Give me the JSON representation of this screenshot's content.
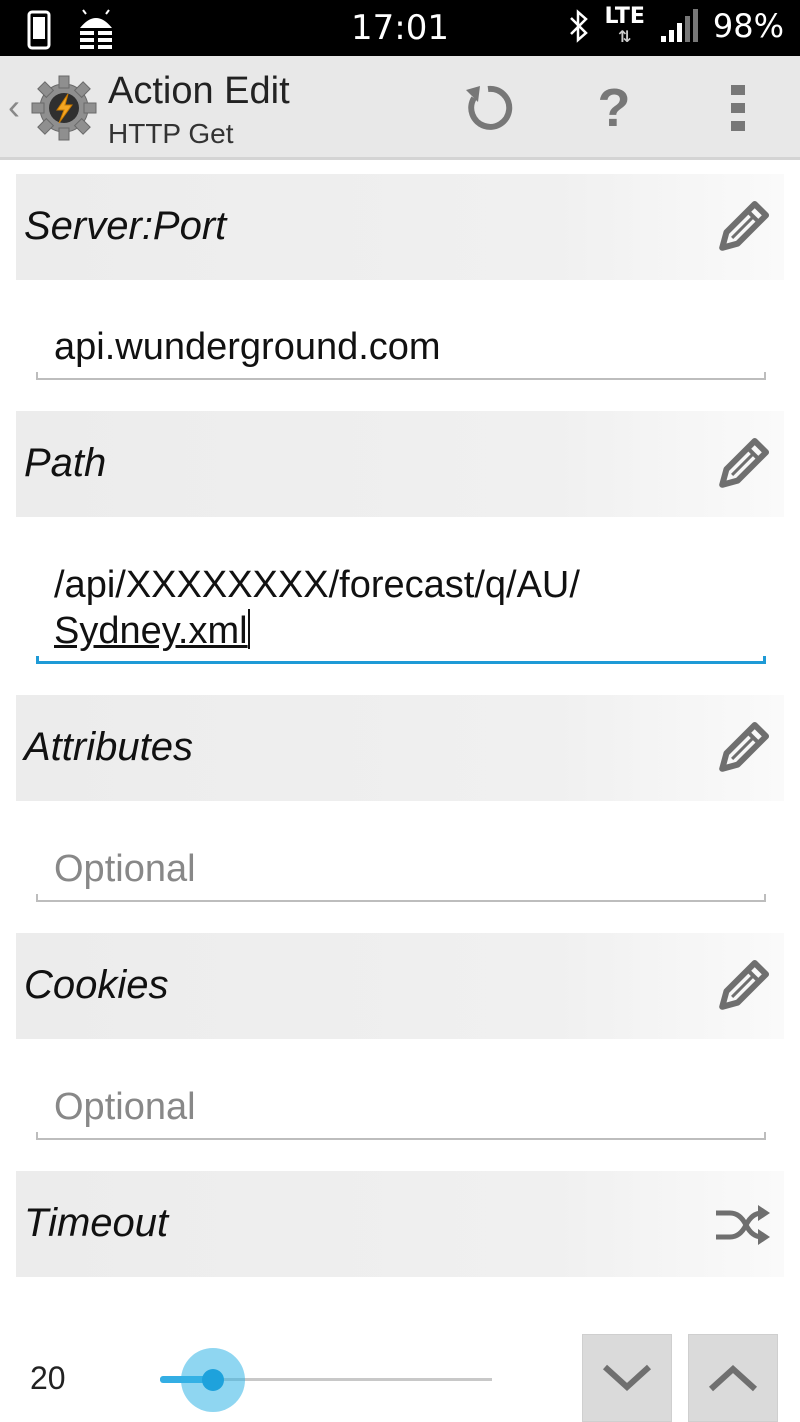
{
  "status_bar": {
    "time": "17:01",
    "network": "LTE",
    "battery": "98%"
  },
  "action_bar": {
    "title": "Action Edit",
    "subtitle": "HTTP Get"
  },
  "sections": {
    "server_port": {
      "label": "Server:Port",
      "value": "api.wunderground.com"
    },
    "path": {
      "label": "Path",
      "value_line1": "/api/XXXXXXXX/forecast/q/AU/",
      "value_line2": "Sydney.xml"
    },
    "attributes": {
      "label": "Attributes",
      "placeholder": "Optional"
    },
    "cookies": {
      "label": "Cookies",
      "placeholder": "Optional"
    },
    "timeout": {
      "label": "Timeout",
      "value": "20",
      "slider_fraction": 0.16
    }
  },
  "colors": {
    "accent": "#33b5e5",
    "active_underline": "#1e9ad6",
    "header_bg": "#ececec",
    "action_bar_bg": "#e8e8e8"
  },
  "icons": {
    "server_port": "pencil-icon",
    "path": "pencil-icon",
    "attributes": "pencil-icon",
    "cookies": "pencil-icon",
    "timeout": "shuffle-icon",
    "refresh": "refresh-icon",
    "help": "help-icon",
    "overflow": "overflow-menu-icon"
  }
}
